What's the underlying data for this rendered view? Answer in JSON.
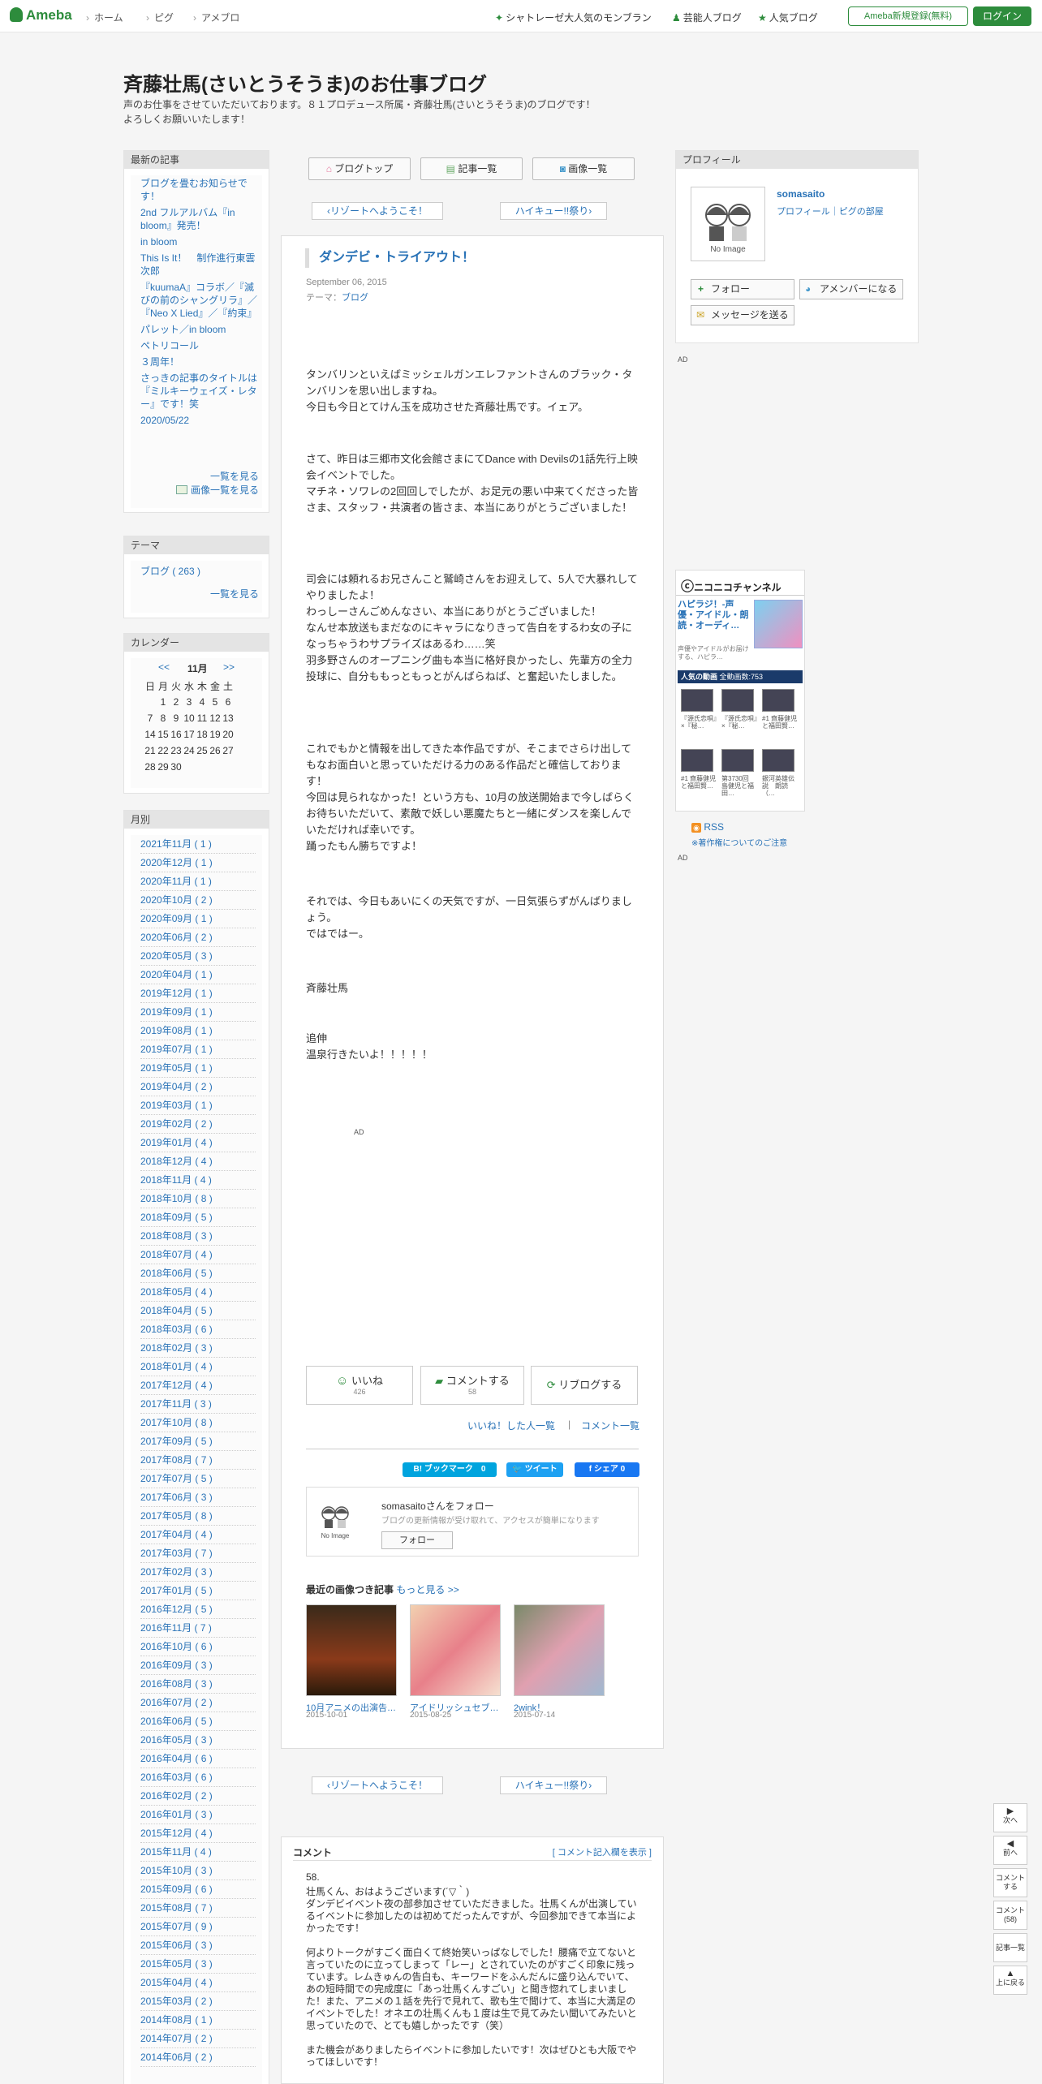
{
  "header": {
    "logo": "Ameba",
    "nav": [
      "ホーム",
      "ピグ",
      "アメブロ"
    ],
    "right_links": [
      "シャトレーゼ大人気のモンブラン",
      "芸能人ブログ",
      "人気ブログ"
    ],
    "register": "Ameba新規登録(無料)",
    "login": "ログイン"
  },
  "blog": {
    "title": "斉藤壮馬(さいとうそうま)のお仕事ブログ",
    "description": "声のお仕事をさせていただいております。８１プロデュース所属・斉藤壮馬(さいとうそうま)のブログです！\nよろしくお願いいたします！"
  },
  "recent": {
    "heading": "最新の記事",
    "items": [
      "ブログを畳むお知らせです！",
      "2nd フルアルバム『in bloom』発売！",
      "in bloom",
      "This Is It！　制作進行東雲次郎",
      "『kuumaA』コラボ／『滅びの前のシャングリラ』／『Neo X Lied』／『約束』",
      "パレット／in bloom",
      "ペトリコール",
      "３周年！",
      "さっきの記事のタイトルは『ミルキーウェイズ・レター』です！笑",
      "2020/05/22"
    ],
    "more": "一覧を見る",
    "more_images": "画像一覧を見る"
  },
  "theme": {
    "heading": "テーマ",
    "item": "ブログ ( 263 )",
    "more": "一覧を見る"
  },
  "calendar": {
    "heading": "カレンダー",
    "prev": "<<",
    "month": "11月",
    "next": ">>",
    "weekdays": [
      "日",
      "月",
      "火",
      "水",
      "木",
      "金",
      "土"
    ],
    "rows": [
      [
        "",
        "1",
        "2",
        "3",
        "4",
        "5",
        "6"
      ],
      [
        "7",
        "8",
        "9",
        "10",
        "11",
        "12",
        "13"
      ],
      [
        "14",
        "15",
        "16",
        "17",
        "18",
        "19",
        "20"
      ],
      [
        "21",
        "22",
        "23",
        "24",
        "25",
        "26",
        "27"
      ],
      [
        "28",
        "29",
        "30",
        "",
        "",
        "",
        ""
      ]
    ]
  },
  "monthly": {
    "heading": "月別",
    "items": [
      "2021年11月 ( 1 )",
      "2020年12月 ( 1 )",
      "2020年11月 ( 1 )",
      "2020年10月 ( 2 )",
      "2020年09月 ( 1 )",
      "2020年06月 ( 2 )",
      "2020年05月 ( 3 )",
      "2020年04月 ( 1 )",
      "2019年12月 ( 1 )",
      "2019年09月 ( 1 )",
      "2019年08月 ( 1 )",
      "2019年07月 ( 1 )",
      "2019年05月 ( 1 )",
      "2019年04月 ( 2 )",
      "2019年03月 ( 1 )",
      "2019年02月 ( 2 )",
      "2019年01月 ( 4 )",
      "2018年12月 ( 4 )",
      "2018年11月 ( 4 )",
      "2018年10月 ( 8 )",
      "2018年09月 ( 5 )",
      "2018年08月 ( 3 )",
      "2018年07月 ( 4 )",
      "2018年06月 ( 5 )",
      "2018年05月 ( 4 )",
      "2018年04月 ( 5 )",
      "2018年03月 ( 6 )",
      "2018年02月 ( 3 )",
      "2018年01月 ( 4 )",
      "2017年12月 ( 4 )",
      "2017年11月 ( 3 )",
      "2017年10月 ( 8 )",
      "2017年09月 ( 5 )",
      "2017年08月 ( 7 )",
      "2017年07月 ( 5 )",
      "2017年06月 ( 3 )",
      "2017年05月 ( 8 )",
      "2017年04月 ( 4 )",
      "2017年03月 ( 7 )",
      "2017年02月 ( 3 )",
      "2017年01月 ( 5 )",
      "2016年12月 ( 5 )",
      "2016年11月 ( 7 )",
      "2016年10月 ( 6 )",
      "2016年09月 ( 3 )",
      "2016年08月 ( 3 )",
      "2016年07月 ( 2 )",
      "2016年06月 ( 5 )",
      "2016年05月 ( 3 )",
      "2016年04月 ( 6 )",
      "2016年03月 ( 6 )",
      "2016年02月 ( 2 )",
      "2016年01月 ( 3 )",
      "2015年12月 ( 4 )",
      "2015年11月 ( 4 )",
      "2015年10月 ( 3 )",
      "2015年09月 ( 6 )",
      "2015年08月 ( 7 )",
      "2015年07月 ( 9 )",
      "2015年06月 ( 3 )",
      "2015年05月 ( 3 )",
      "2015年04月 ( 4 )",
      "2015年03月 ( 2 )",
      "2014年08月 ( 1 )",
      "2014年07月 ( 2 )",
      "2014年06月 ( 2 )"
    ]
  },
  "tabs": {
    "top": "ブログトップ",
    "list": "記事一覧",
    "images": "画像一覧"
  },
  "pager": {
    "prev": "リゾートへようこそ！",
    "next": "ハイキュー!!祭り"
  },
  "entry": {
    "title": "ダンデビ・トライアウト！",
    "date": "September 06, 2015",
    "theme_label": "テーマ：",
    "theme": "ブログ",
    "p1": "タンバリンといえばミッシェルガンエレファントさんのブラック・タンバリンを思い出しますね。\n今日も今日とてけん玉を成功させた斉藤壮馬です。イェア。",
    "p2": "さて、昨日は三郷市文化会館さまにてDance with Devilsの1話先行上映会イベントでした。\nマチネ・ソワレの2回回しでしたが、お足元の悪い中来てくださった皆さま、スタッフ・共演者の皆さま、本当にありがとうございました！",
    "p3": "司会には頼れるお兄さんこと鷲崎さんをお迎えして、5人で大暴れしてやりましたよ！\nわっしーさんごめんなさい、本当にありがとうございました！\nなんせ本放送もまだなのにキャラになりきって告白をするわ女の子になっちゃうわサプライズはあるわ……笑\n羽多野さんのオープニング曲も本当に格好良かったし、先輩方の全力投球に、自分ももっともっとがんばらねば、と奮起いたしました。",
    "p4": "これでもかと情報を出してきた本作品ですが、そこまでさらけ出してもなお面白いと思っていただける力のある作品だと確信しております！\n今回は見られなかった！という方も、10月の放送開始まで今しばらくお待ちいただいて、素敵で妖しい悪魔たちと一緒にダンスを楽しんでいただければ幸いです。\n踊ったもん勝ちですよ！",
    "p5": "それでは、今日もあいにくの天気ですが、一日気張らずがんばりましょう。\nではではー。",
    "p6": "斉藤壮馬",
    "p7": "追伸\n温泉行きたいよ！！！！！",
    "ad": "AD"
  },
  "reactions": {
    "like": "いいね",
    "like_count": "426",
    "comment": "コメントする",
    "comment_count": "58",
    "reblog": "リブログする",
    "liked_users": "いいね！した人一覧",
    "comment_list": "コメント一覧"
  },
  "share": {
    "hatena": "B! ブックマーク　0",
    "tweet": "ツイート",
    "facebook": "シェア 0"
  },
  "follow_box": {
    "name": "somasaitoさんをフォロー",
    "desc": "ブログの更新情報が受け取れて、アクセスが簡単になります",
    "button": "フォロー",
    "noimage": "No Image"
  },
  "recent_images": {
    "heading": "最近の画像つき記事",
    "more": "もっと見る >>",
    "items": [
      {
        "title": "10月アニメの出演告…",
        "date": "2015-10-01"
      },
      {
        "title": "アイドリッシュセブ…",
        "date": "2015-08-25"
      },
      {
        "title": "2wink！",
        "date": "2015-07-14"
      }
    ]
  },
  "profile": {
    "heading": "プロフィール",
    "name": "somasaito",
    "links": "プロフィール｜ピグの部屋",
    "noimage": "No Image",
    "follow": "フォロー",
    "member": "アメンバーになる",
    "message": "メッセージを送る",
    "ad": "AD"
  },
  "nico": {
    "brand": "ニコニコチャンネル",
    "title": "ハピラジ！-声優・アイドル・朗読・オーディ…",
    "desc": "声優やアイドルがお届けする、ハピラ…",
    "popular": "人気の動画",
    "total": "全動画数:753",
    "videos": [
      "『源氏恋唄』×『秘…",
      "『源氏恋唄』×『秘…",
      "#1 齋藤健児と福田賢…",
      "#1 齋藤健児と福田賢…",
      "第3730回 島健児と福田…",
      "銀河英雄伝説　朗読（…"
    ]
  },
  "rss": {
    "label": "RSS",
    "note": "※著作権についてのご注意",
    "ad": "AD"
  },
  "float": {
    "next": "次へ",
    "prev": "前へ",
    "comment": "コメントする",
    "comment_count": "コメント (58)",
    "list": "記事一覧",
    "top": "上に戻る"
  },
  "comments": {
    "heading": "コメント",
    "show_form": "[ コメント記入欄を表示 ]",
    "number": "58.",
    "body": "壮馬くん、おはようございます(´▽｀)\nダンデビイベント夜の部参加させていただきました。壮馬くんが出演しているイベントに参加したのは初めてだったんですが、今回参加できて本当によかったです！\n\n何よりトークがすごく面白くて終始笑いっぱなしでした！腰痛で立てないと言っていたのに立ってしまって「レー」とされていたのがすごく印象に残っています。レムきゅんの告白も、キーワードをふんだんに盛り込んでいて、あの短時間での完成度に「あっ壮馬くんすごい」と聞き惚れてしまいました！また、アニメの１話を先行で見れて、歌も生で聞けて、本当に大満足のイベントでした！オネエの壮馬くんも１度は生で見てみたい聞いてみたいと思っていたので、とても嬉しかったです（笑）\n\nまた機会がありましたらイベントに参加したいです！次はぜひとも大阪でやってほしいです！"
  }
}
